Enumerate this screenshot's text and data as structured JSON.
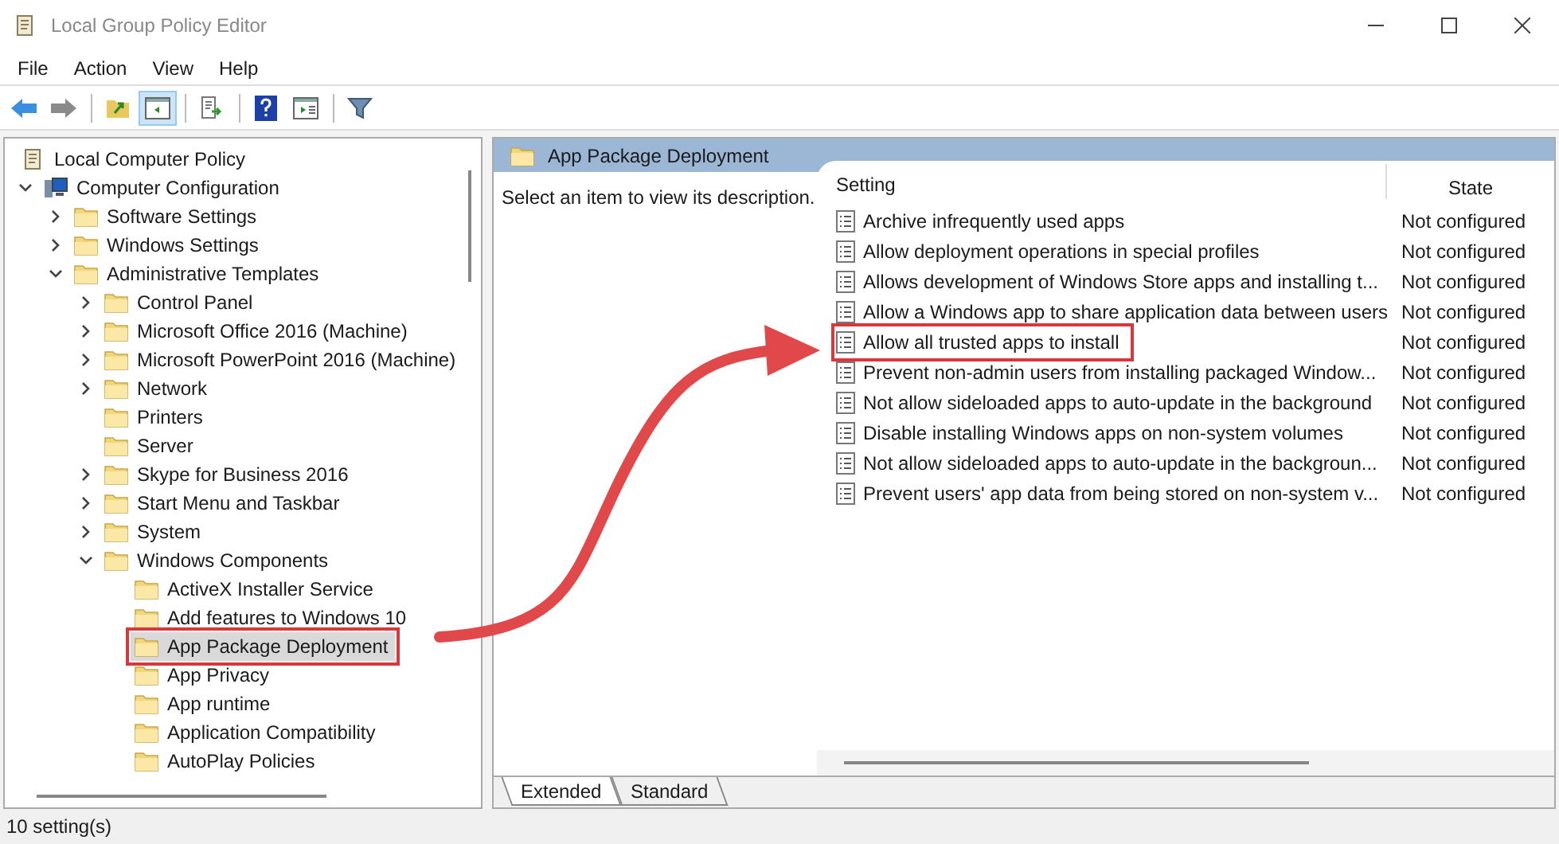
{
  "window": {
    "title": "Local Group Policy Editor"
  },
  "menu": [
    "File",
    "Action",
    "View",
    "Help"
  ],
  "toolbar": [
    {
      "kind": "back",
      "selected": false
    },
    {
      "kind": "forward",
      "selected": false
    },
    {
      "kind": "up",
      "selected": false
    },
    {
      "kind": "tree",
      "selected": true
    },
    {
      "kind": "export",
      "selected": false
    },
    {
      "kind": "help",
      "selected": false
    },
    {
      "kind": "pane",
      "selected": false
    },
    {
      "kind": "filter",
      "selected": false
    }
  ],
  "tree": [
    {
      "label": "Local Computer Policy",
      "kind": "policy",
      "selected": false,
      "callout": false,
      "children": [
        {
          "label": "Computer Configuration",
          "kind": "computer",
          "expanded": true,
          "selected": false,
          "callout": false,
          "children": [
            {
              "label": "Software Settings",
              "kind": "folder",
              "expanded": false,
              "selected": false,
              "callout": false
            },
            {
              "label": "Windows Settings",
              "kind": "folder",
              "expanded": false,
              "selected": false,
              "callout": false
            },
            {
              "label": "Administrative Templates",
              "kind": "folder",
              "expanded": true,
              "selected": false,
              "callout": false,
              "children": [
                {
                  "label": "Control Panel",
                  "kind": "folder",
                  "expanded": false,
                  "selected": false,
                  "callout": false
                },
                {
                  "label": "Microsoft Office 2016 (Machine)",
                  "kind": "folder",
                  "expanded": false,
                  "selected": false,
                  "callout": false
                },
                {
                  "label": "Microsoft PowerPoint 2016 (Machine)",
                  "kind": "folder",
                  "expanded": false,
                  "selected": false,
                  "callout": false
                },
                {
                  "label": "Network",
                  "kind": "folder",
                  "expanded": false,
                  "selected": false,
                  "callout": false
                },
                {
                  "label": "Printers",
                  "kind": "folder",
                  "selected": false,
                  "callout": false
                },
                {
                  "label": "Server",
                  "kind": "folder",
                  "selected": false,
                  "callout": false
                },
                {
                  "label": "Skype for Business 2016",
                  "kind": "folder",
                  "expanded": false,
                  "selected": false,
                  "callout": false
                },
                {
                  "label": "Start Menu and Taskbar",
                  "kind": "folder",
                  "expanded": false,
                  "selected": false,
                  "callout": false
                },
                {
                  "label": "System",
                  "kind": "folder",
                  "expanded": false,
                  "selected": false,
                  "callout": false
                },
                {
                  "label": "Windows Components",
                  "kind": "folder",
                  "expanded": true,
                  "selected": false,
                  "callout": false,
                  "children": [
                    {
                      "label": "ActiveX Installer Service",
                      "kind": "folder",
                      "selected": false,
                      "callout": false
                    },
                    {
                      "label": "Add features to Windows 10",
                      "kind": "folder",
                      "selected": false,
                      "callout": false
                    },
                    {
                      "label": "App Package Deployment",
                      "kind": "folder",
                      "selected": true,
                      "callout": true
                    },
                    {
                      "label": "App Privacy",
                      "kind": "folder",
                      "selected": false,
                      "callout": false
                    },
                    {
                      "label": "App runtime",
                      "kind": "folder",
                      "selected": false,
                      "callout": false
                    },
                    {
                      "label": "Application Compatibility",
                      "kind": "folder",
                      "selected": false,
                      "callout": false
                    },
                    {
                      "label": "AutoPlay Policies",
                      "kind": "folder",
                      "selected": false,
                      "callout": false
                    }
                  ]
                }
              ]
            }
          ]
        }
      ]
    }
  ],
  "header": {
    "title": "App Package Deployment"
  },
  "description": "Select an item to view its description.",
  "table": {
    "columns": [
      "Setting",
      "State"
    ],
    "rows": [
      {
        "setting": "Archive infrequently used apps",
        "state": "Not configured",
        "callout": false
      },
      {
        "setting": "Allow deployment operations in special profiles",
        "state": "Not configured",
        "callout": false
      },
      {
        "setting": "Allows development of Windows Store apps and installing t...",
        "state": "Not configured",
        "callout": false
      },
      {
        "setting": "Allow a Windows app to share application data between users",
        "state": "Not configured",
        "callout": false
      },
      {
        "setting": "Allow all trusted apps to install",
        "state": "Not configured",
        "callout": true
      },
      {
        "setting": "Prevent non-admin users from installing packaged Window...",
        "state": "Not configured",
        "callout": false
      },
      {
        "setting": "Not allow sideloaded apps to auto-update in the background",
        "state": "Not configured",
        "callout": false
      },
      {
        "setting": "Disable installing Windows apps on non-system volumes",
        "state": "Not configured",
        "callout": false
      },
      {
        "setting": "Not allow sideloaded apps to auto-update in the backgroun...",
        "state": "Not configured",
        "callout": false
      },
      {
        "setting": "Prevent users' app data from being stored on non-system v...",
        "state": "Not configured",
        "callout": false
      }
    ]
  },
  "tabs": [
    {
      "label": "Extended",
      "selected": true
    },
    {
      "label": "Standard",
      "selected": false
    }
  ],
  "status_bar": "10 setting(s)"
}
